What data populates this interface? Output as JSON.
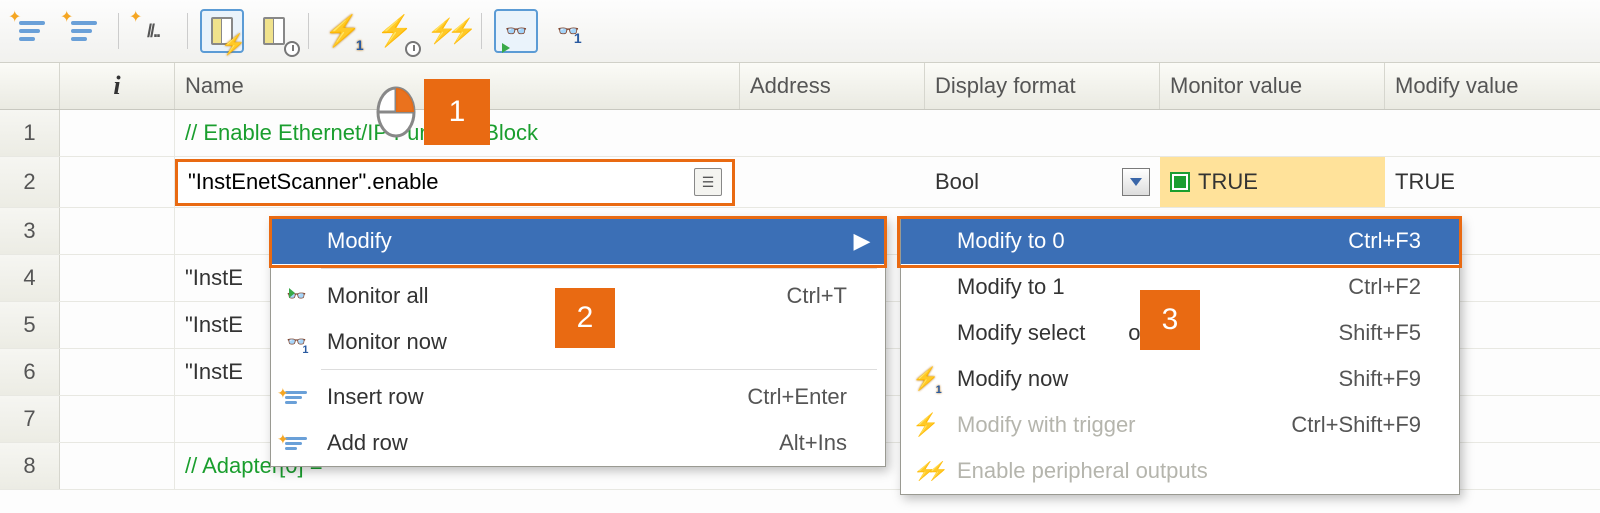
{
  "toolbar_icons": [
    "lines-new-1",
    "lines-new-2",
    "comment-new",
    "columns-bolt",
    "columns-clock",
    "bolt-1",
    "bolt-clock",
    "bolt-double",
    "glasses-play",
    "glasses-1"
  ],
  "headers": {
    "info": "i",
    "name": "Name",
    "address": "Address",
    "display_format": "Display format",
    "monitor_value": "Monitor value",
    "modify_value": "Modify value"
  },
  "rows": [
    {
      "num": "1",
      "name": "// Enable Ethernet/IP Function Block",
      "comment": true
    },
    {
      "num": "2",
      "name": "\"InstEnetScanner\".enable",
      "display_format": "Bool",
      "monitor_value": "TRUE",
      "modify_value": "TRUE",
      "editing": true
    },
    {
      "num": "3",
      "name": ""
    },
    {
      "num": "4",
      "name": "\"InstE"
    },
    {
      "num": "5",
      "name": "\"InstE"
    },
    {
      "num": "6",
      "name": "\"InstE"
    },
    {
      "num": "7",
      "name": ""
    },
    {
      "num": "8",
      "name": "// Adapter[0] =",
      "comment": true
    }
  ],
  "callouts": {
    "c1": "1",
    "c2": "2",
    "c3": "3"
  },
  "menu1": {
    "items": [
      {
        "label": "Modify",
        "shortcut": "",
        "selected": true,
        "submenu": true
      },
      {
        "sep": true
      },
      {
        "label": "Monitor all",
        "shortcut": "Ctrl+T",
        "icon": "glasses-play"
      },
      {
        "label": "Monitor now",
        "shortcut": "",
        "icon": "glasses-1"
      },
      {
        "sep": true
      },
      {
        "label": "Insert row",
        "shortcut": "Ctrl+Enter",
        "icon": "lines-new"
      },
      {
        "label": "Add row",
        "shortcut": "Alt+Ins",
        "icon": "lines-new"
      }
    ]
  },
  "menu2": {
    "items": [
      {
        "label": "Modify to 0",
        "shortcut": "Ctrl+F3",
        "selected": true
      },
      {
        "label": "Modify to 1",
        "shortcut": "Ctrl+F2"
      },
      {
        "label": "Modify selected now",
        "shortcut": "Shift+F5",
        "covered_label_prefix": "Modify select",
        "covered_label_suffix": "ow"
      },
      {
        "label": "Modify now",
        "shortcut": "Shift+F9",
        "icon": "bolt-1"
      },
      {
        "label": "Modify with trigger",
        "shortcut": "Ctrl+Shift+F9",
        "disabled": true,
        "icon": "bolt-clock-grey"
      },
      {
        "label": "Enable peripheral outputs",
        "shortcut": "",
        "disabled": true,
        "icon": "bolt-double-grey"
      }
    ]
  }
}
